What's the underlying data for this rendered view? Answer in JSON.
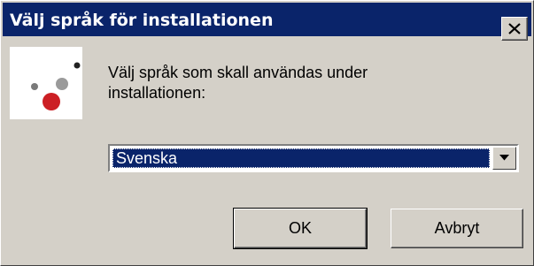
{
  "window": {
    "title": "Välj språk för installationen",
    "close_icon": "close-icon"
  },
  "colors": {
    "titlebar": "#0a246a",
    "dialog_background": "#d4d0c8",
    "selection": "#0a246a",
    "icon_red": "#cc1f24",
    "icon_gray": "#9a9a9a",
    "icon_dark": "#222222"
  },
  "main": {
    "icon": "setup-logo-icon",
    "prompt": "Välj språk som skall användas under installationen:",
    "language_select": {
      "selected": "Svenska",
      "arrow_icon": "chevron-down-icon"
    }
  },
  "buttons": {
    "ok_label": "OK",
    "cancel_label": "Avbryt"
  }
}
